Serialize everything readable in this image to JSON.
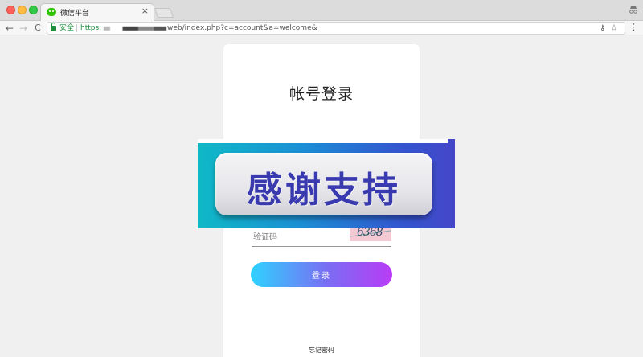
{
  "browser": {
    "tab": {
      "title": "微信平台",
      "close_label": "×"
    },
    "toolbar": {
      "back_label": "←",
      "forward_label": "→",
      "reload_label": "C",
      "secure_label": "安全",
      "url_scheme": "https:",
      "url_rest": "web/index.php?c=account&a=welcome&",
      "key_label": "⚷",
      "star_label": "☆",
      "menu_label": "⋮"
    }
  },
  "login": {
    "title": "帐号登录",
    "captcha_placeholder": "验证码",
    "captcha_code": "6368",
    "login_button_label": "登录",
    "forgot_password_label": "忘记密码"
  },
  "banner": {
    "text": "感谢支持"
  },
  "colors": {
    "button_gradient_start": "#2fd2ff",
    "button_gradient_end": "#b93cf6",
    "banner_text": "#3a3ab0",
    "secure_green": "#1e8e3e"
  }
}
